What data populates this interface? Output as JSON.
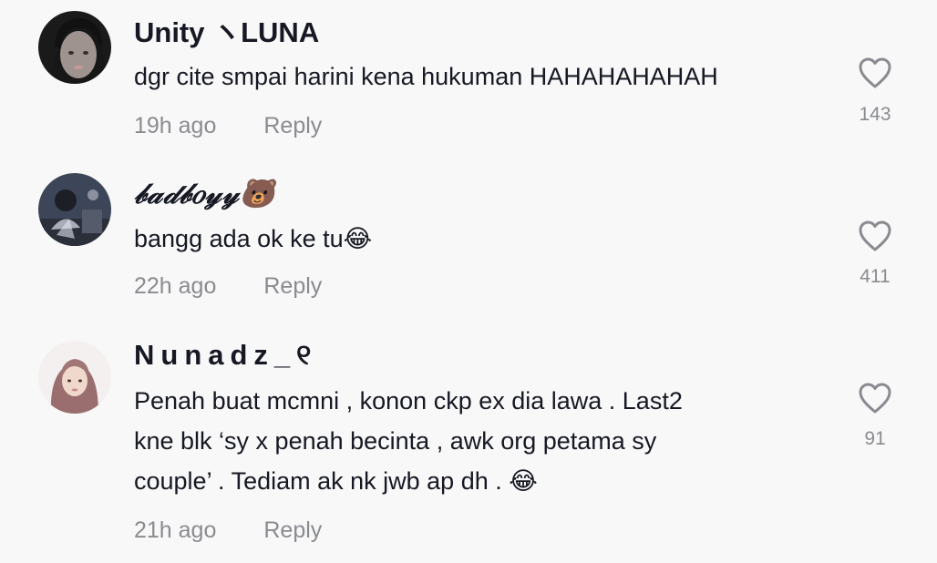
{
  "comments": [
    {
      "username": "Unity』LUNA",
      "username_display": "Unity ヽLUNA",
      "text_lines": [
        "dgr cite smpai harini kena hukuman HAHAHAHAHAH"
      ],
      "time": "19h ago",
      "reply_label": "Reply",
      "likes": "143"
    },
    {
      "username": "𝒷𝒶𝒹𝒷𝑜𝓎𝓎🐻",
      "username_display": "𝒷𝒶𝒹𝒷𝑜𝓎𝓎🐻",
      "text_lines": [
        "bangg ada ok ke tu😂"
      ],
      "time": "22h ago",
      "reply_label": "Reply",
      "likes": "411"
    },
    {
      "username": "Nunadz_ᶠᵃ",
      "username_display": "Nunadz_୧",
      "text_lines": [
        "Penah buat mcmni , konon ckp ex dia lawa . Last2",
        "kne blk ‘sy x penah becinta , awk org petama sy",
        "couple’ . Tediam ak nk jwb ap dh . 😂"
      ],
      "time": "21h ago",
      "reply_label": "Reply",
      "likes": "91"
    }
  ],
  "icons": {
    "like": "heart-outline-icon"
  },
  "colors": {
    "background": "#f8f8f8",
    "primary_text": "#161823",
    "secondary_text": "#8a8b91"
  }
}
